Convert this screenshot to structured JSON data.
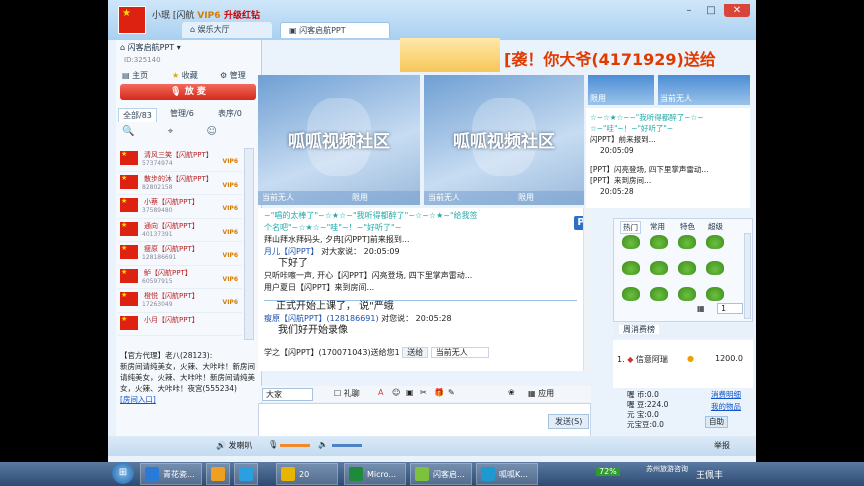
{
  "window": {
    "user": "小珉",
    "user_tag": "[闪航",
    "vip_tag": "VIP6",
    "upgrade": "升级红钻",
    "controls": {
      "min": "–",
      "max": "□",
      "close": "✕"
    }
  },
  "tabs": {
    "lobby": "娱乐大厅",
    "room": "闪客启航PPT"
  },
  "left": {
    "room_name": "闪客启航PPT",
    "room_id": "ID:325140",
    "links": [
      "主页",
      "收藏",
      "管理"
    ],
    "mic_button": "放 麦",
    "list_tabs": [
      "全部/83",
      "管理/6",
      "表序/0"
    ],
    "users": [
      {
        "name": "清风三笑【闪航PPT】",
        "id": "57374974",
        "badge": "VIP6"
      },
      {
        "name": "散步的沐【闪航PPT】",
        "id": "82802158",
        "badge": "VIP6"
      },
      {
        "name": "小蔡【闪航PPT】",
        "id": "37589480",
        "badge": "VIP6"
      },
      {
        "name": "通向【闪航PPT】",
        "id": "40137391",
        "badge": "VIP6"
      },
      {
        "name": "瘦原【闪航PPT】",
        "id": "128186691",
        "badge": "VIP6"
      },
      {
        "name": "鲈【闪航PPT】",
        "id": "60597915",
        "badge": "VIP6"
      },
      {
        "name": "橙悦【闪航PPT】",
        "id": "17263049",
        "badge": "VIP6"
      },
      {
        "name": "小月【闪航PPT】",
        "id": "",
        "badge": ""
      }
    ],
    "notice_title": "【官方代理】老八(28123):",
    "notice_body": "新房间请纯美女，火辣、大咔咔！新房间请纯美女，火辣、大咔咔！新房间请纯美女，火辣、大咔咔！夜宫(555234)",
    "notice_link": "[房间入口]"
  },
  "banner": {
    "text": "[袭！你大爷(4171929)送给"
  },
  "videos": {
    "logo": "呱呱视频社区",
    "v1_label_a": "当前无人",
    "v1_label_b": "限用",
    "v2_label_a": "当前无人",
    "v2_label_b": "限用",
    "sv1_label": "限用",
    "sv2_label": "当前无人"
  },
  "right_chat": {
    "l1": "☆~☆★☆~~\"我听得都醉了~☆~",
    "l2": "☆~\"哇\"~！~\"好听了\"~",
    "l3": "闪PPT】前来报到...",
    "l4": "20:05:09",
    "l5": "[PPT】闪亮登场, 四下里掌声雷动...",
    "l6": "[PPT】来到房间...",
    "l7": "20:05:28"
  },
  "chat": {
    "l1": "~\"唱的太棒了\"~☆★☆~\"我听得都醉了\"~☆~☆★~\"给我签",
    "l2": "个名吧\"~☆★☆~\"哇\"~！~\"好听了\"~",
    "l3": "拜山拜水拜码头, 夕冉[闪PPT]前来报到...",
    "l4_user": "月儿【闪PPT】",
    "l4_rest": "对大家说：  20:05:09",
    "l5": "下好了",
    "l6": "只听咔嚓一声, 开心【闪PPT】闪亮登场, 四下里掌声雷动...",
    "l7": "用户夏日【闪PPT】来到房间...",
    "l8": "正式开始上课了，  说\"严蛾",
    "l9_user": "瘦原【闪航PPT】(128186691)",
    "l9_rest": "对您说：  20:05:28",
    "l10": "我们好开始录像",
    "gift_line": "学之【闪PPT】(170071043)送给您1",
    "gift_to": "送给",
    "gift_target": "当前无人"
  },
  "toolbar": {
    "target": "大家",
    "gift": "礼聊",
    "send": "发送(S)",
    "app": "应用"
  },
  "emo": {
    "tabs": [
      "热门",
      "常用",
      "特色",
      "超级"
    ],
    "page": "1",
    "rank_tab": "周消费榜",
    "rank_no": "1.",
    "rank_name": "信意阿瑞",
    "rank_value": "1200.0"
  },
  "wallet": {
    "r1": "喔  币:0.0",
    "r2": "喔  豆:224.0",
    "r3": "元  宝:0.0",
    "r4": "元宝豆:0.0",
    "link1": "消费明细",
    "link2": "我的物品",
    "auto": "自助"
  },
  "bottom": {
    "talk": "发喇叭",
    "report": "举报"
  },
  "taskbar": {
    "items": [
      "青花瓷...",
      "",
      "",
      "20",
      "Micro...",
      "闪客启...",
      "呱呱K..."
    ],
    "battery": "72%",
    "tray_text": "苏州旅游咨询",
    "user": "王佩丰"
  }
}
